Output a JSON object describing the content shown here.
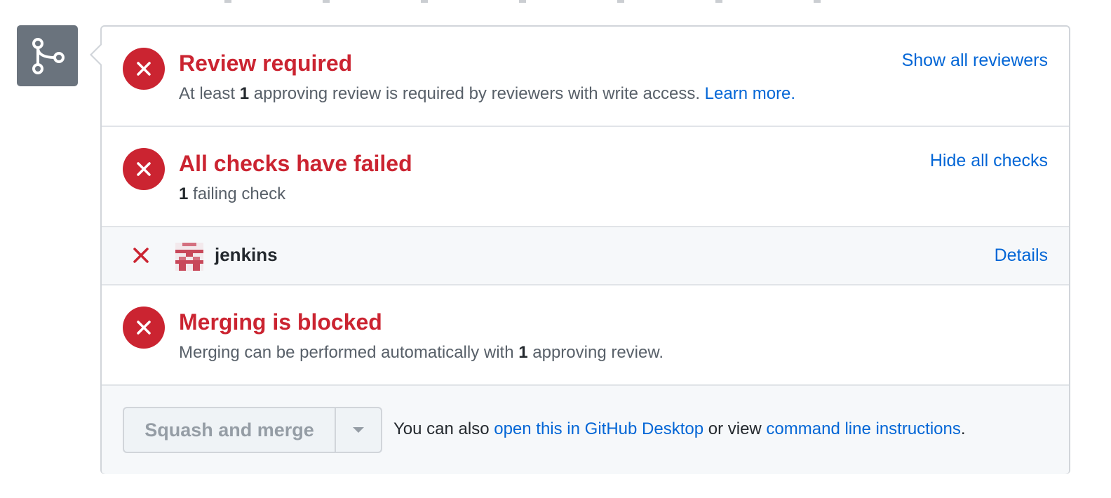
{
  "merge_icon": "git-merge-icon",
  "colors": {
    "error_red": "#cb2431",
    "link_blue": "#0366d6",
    "muted_text": "#586069",
    "border": "#d1d5da",
    "panel_bg": "#f6f8fa",
    "avatar_gray": "#6a737d"
  },
  "review": {
    "icon": "x-circle-icon",
    "title": "Review required",
    "desc_prefix": "At least ",
    "desc_count": "1",
    "desc_suffix": " approving review is required by reviewers with write access. ",
    "learn_more": "Learn more.",
    "action": "Show all reviewers"
  },
  "checks": {
    "icon": "x-circle-icon",
    "title": "All checks have failed",
    "desc_count": "1",
    "desc_suffix": " failing check",
    "action": "Hide all checks",
    "items": [
      {
        "status_icon": "x-icon",
        "avatar": "jenkins-avatar",
        "name": "jenkins",
        "action": "Details"
      }
    ]
  },
  "merge_status": {
    "icon": "x-circle-icon",
    "title": "Merging is blocked",
    "desc_prefix": "Merging can be performed automatically with ",
    "desc_count": "1",
    "desc_suffix": " approving review."
  },
  "actions": {
    "merge_button": "Squash and merge",
    "dropdown_icon": "caret-down-icon",
    "also_prefix": "You can also ",
    "desktop_link": "open this in GitHub Desktop",
    "also_middle": " or view ",
    "cli_link": "command line instructions",
    "also_suffix": "."
  }
}
